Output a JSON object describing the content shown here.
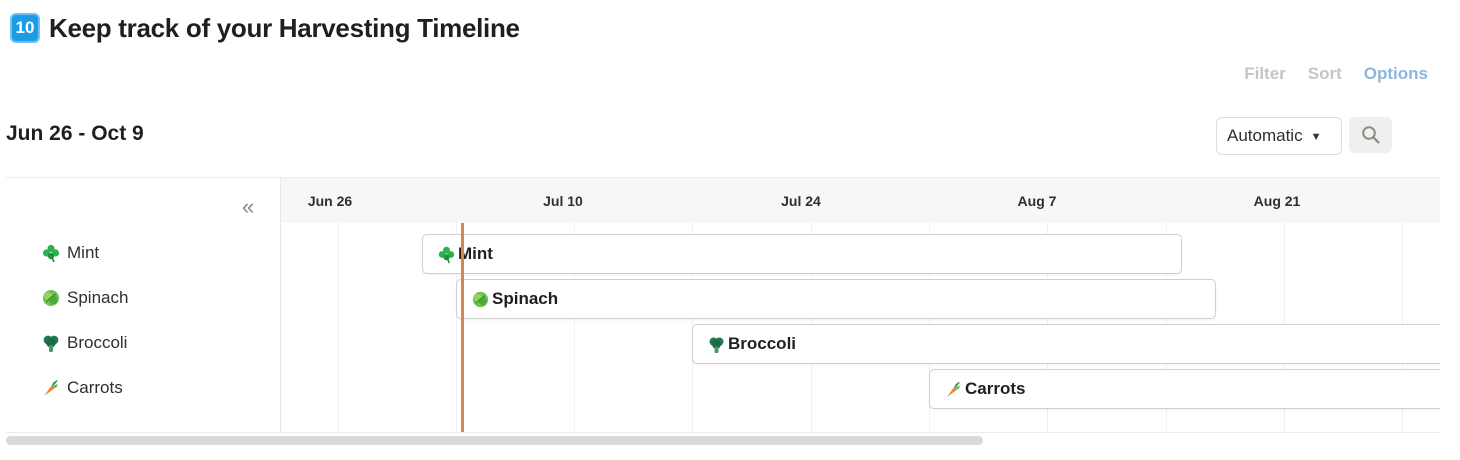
{
  "page": {
    "badge": "10",
    "title": "Keep track of your Harvesting Timeline"
  },
  "view_actions": {
    "filter": "Filter",
    "sort": "Sort",
    "options": "Options"
  },
  "timeline": {
    "range_title": "Jun 26 - Oct 9",
    "zoom_select": "Automatic",
    "dates": [
      "Jun 26",
      "Jul 10",
      "Jul 24",
      "Aug 7",
      "Aug 21"
    ],
    "rows": [
      {
        "name": "Mint",
        "icon": "shamrock-icon"
      },
      {
        "name": "Spinach",
        "icon": "lettuce-icon"
      },
      {
        "name": "Broccoli",
        "icon": "broccoli-icon"
      },
      {
        "name": "Carrots",
        "icon": "carrot-icon"
      }
    ]
  },
  "colors": {
    "today_line": "#d9854c",
    "options_link": "#8fb6d9",
    "badge": "#1c9be6"
  }
}
